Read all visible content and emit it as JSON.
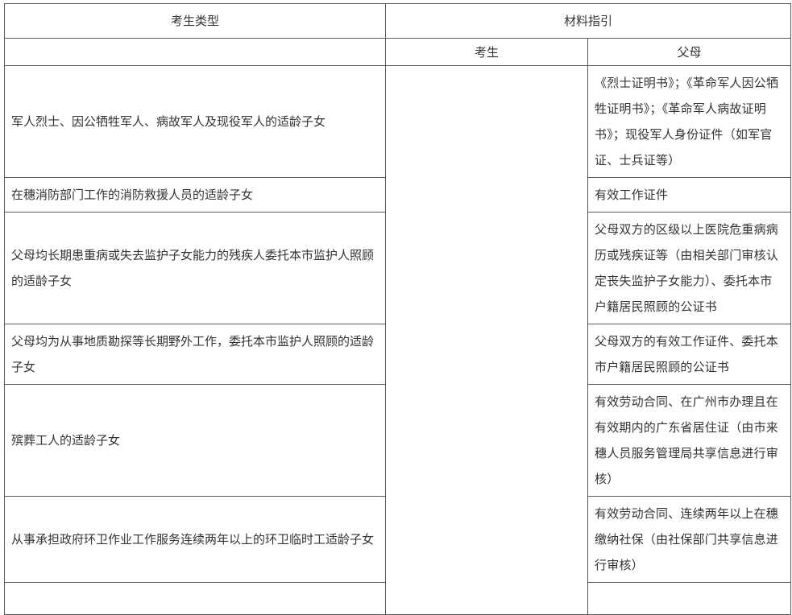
{
  "header": {
    "type_col": "考生类型",
    "material_col": "材料指引",
    "student_col": "考生",
    "parent_col": "父母"
  },
  "rows": [
    {
      "type": "军人烈士、因公牺牲军人、病故军人及现役军人的适龄子女",
      "parent": "《烈士证明书》；《革命军人因公牺牲证明书》；《革命军人病故证明书》；现役军人身份证件（如军官证、士兵证等）"
    },
    {
      "type": "在穗消防部门工作的消防救援人员的适龄子女",
      "parent": "有效工作证件"
    },
    {
      "type": "父母均长期患重病或失去监护子女能力的残疾人委托本市监护人照顾的适龄子女",
      "parent": "父母双方的区级以上医院危重病病历或残疾证等（由相关部门审核认定丧失监护子女能力）、委托本市户籍居民照顾的公证书"
    },
    {
      "type": "父母均为从事地质勘探等长期野外工作，委托本市监护人照顾的适龄子女",
      "parent": "父母双方的有效工作证件、委托本市户籍居民照顾的公证书"
    },
    {
      "type": "殡葬工人的适龄子女",
      "parent": "有效劳动合同、在广州市办理且在有效期内的广东省居住证（由市来穗人员服务管理局共享信息进行审核）"
    },
    {
      "type": "从事承担政府环卫作业工作服务连续两年以上的环卫临时工适龄子女",
      "parent": "有效劳动合同、连续两年以上在穗缴纳社保（由社保部门共享信息进行审核）"
    }
  ]
}
